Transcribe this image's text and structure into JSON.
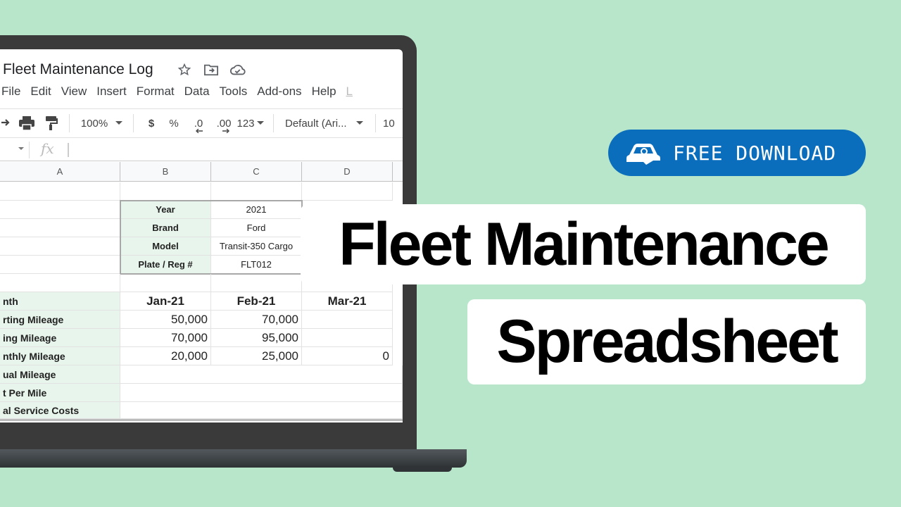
{
  "app": {
    "doc_title": "Fleet Maintenance Log",
    "title_icons": [
      "star-icon",
      "move-to-folder-icon",
      "cloud-saved-icon"
    ],
    "menu": [
      "File",
      "Edit",
      "View",
      "Insert",
      "Format",
      "Data",
      "Tools",
      "Add-ons",
      "Help",
      "L"
    ],
    "toolbar": {
      "zoom": "100%",
      "currency": "$",
      "percent": "%",
      "decrease_decimal": ".0",
      "increase_decimal": ".00",
      "number_format": "123",
      "font": "Default (Ari...",
      "font_size": "10"
    },
    "formula_bar": {
      "fx": "fx",
      "value": ""
    }
  },
  "sheet": {
    "columns": [
      "A",
      "B",
      "C",
      "D"
    ],
    "vehicle_info": [
      {
        "label": "Year",
        "value": "2021"
      },
      {
        "label": "Brand",
        "value": "Ford"
      },
      {
        "label": "Model",
        "value": "Transit-350 Cargo"
      },
      {
        "label": "Plate / Reg #",
        "value": "FLT012"
      }
    ],
    "month_header": {
      "label": "nth",
      "months": [
        "Jan-21",
        "Feb-21",
        "Mar-21"
      ]
    },
    "rows": [
      {
        "label": "rting Mileage",
        "values": [
          "50,000",
          "70,000",
          ""
        ]
      },
      {
        "label": "ing Mileage",
        "values": [
          "70,000",
          "95,000",
          ""
        ]
      },
      {
        "label": "nthly Mileage",
        "values": [
          "20,000",
          "25,000",
          "0"
        ]
      },
      {
        "label": "ual Mileage",
        "values": [
          "",
          "",
          ""
        ]
      },
      {
        "label": "t Per Mile",
        "values": [
          "",
          "",
          ""
        ]
      },
      {
        "label": "al Service Costs",
        "values": [
          "",
          "",
          ""
        ]
      }
    ]
  },
  "promo": {
    "badge_label": "FREE DOWNLOAD",
    "badge_color": "#0a6ebd",
    "background_color": "#b8e6cb",
    "title_line1": "Fleet Maintenance",
    "title_line2": "Spreadsheet"
  }
}
